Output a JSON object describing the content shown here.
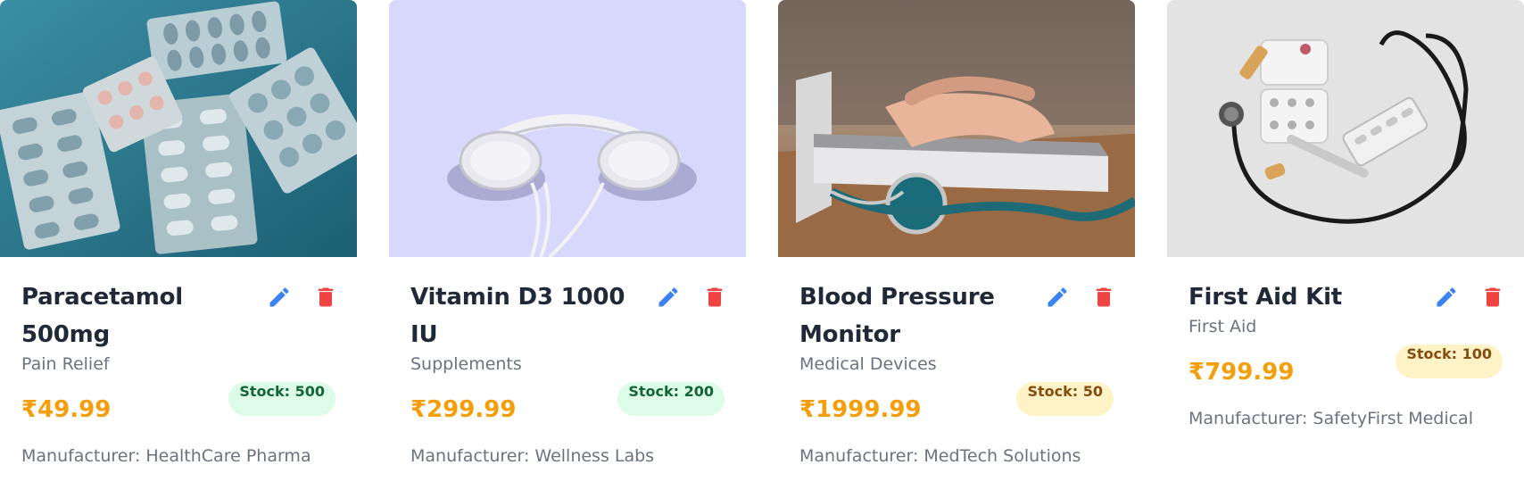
{
  "products": [
    {
      "name": "Paracetamol 500mg",
      "category": "Pain Relief",
      "price": "₹49.99",
      "stock": "Stock: 500",
      "stock_level": "high",
      "manufacturer": "Manufacturer: HealthCare Pharma",
      "image_icon": "pills-blister-image"
    },
    {
      "name": "Vitamin D3 1000 IU",
      "category": "Supplements",
      "price": "₹299.99",
      "stock": "Stock: 200",
      "stock_level": "high",
      "manufacturer": "Manufacturer: Wellness Labs",
      "image_icon": "headphones-image"
    },
    {
      "name": "Blood Pressure Monitor",
      "category": "Medical Devices",
      "price": "₹1999.99",
      "stock": "Stock: 50",
      "stock_level": "low",
      "manufacturer": "Manufacturer: MedTech Solutions",
      "image_icon": "laptop-stethoscope-image"
    },
    {
      "name": "First Aid Kit",
      "category": "First Aid",
      "price": "₹799.99",
      "stock": "Stock: 100",
      "stock_level": "low",
      "manufacturer": "Manufacturer: SafetyFirst Medical",
      "image_icon": "stethoscope-kit-image"
    }
  ],
  "colors": {
    "price": "#f59e0b",
    "edit": "#3b82f6",
    "delete": "#ef4444",
    "stock_high_bg": "#dcfce7",
    "stock_low_bg": "#fef3c7"
  }
}
